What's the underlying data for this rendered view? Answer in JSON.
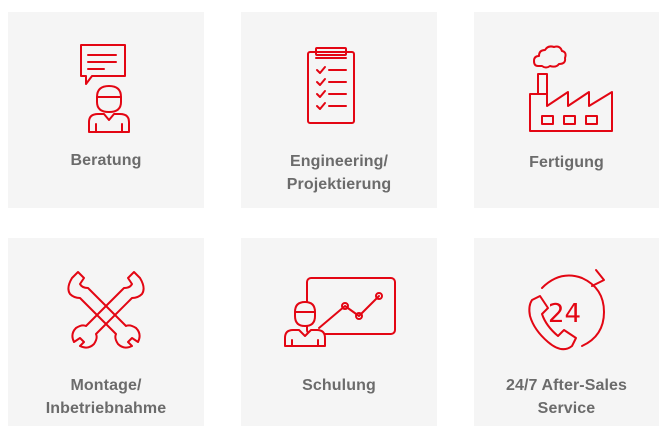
{
  "accent_color": "#e30613",
  "tile_background": "#f5f5f5",
  "label_color": "#6b6b6b",
  "services": [
    {
      "icon": "consultation-icon",
      "label_lines": [
        "Beratung"
      ]
    },
    {
      "icon": "checklist-clipboard-icon",
      "label_lines": [
        "Engineering/",
        "Projektierung"
      ]
    },
    {
      "icon": "factory-icon",
      "label_lines": [
        "Fertigung"
      ]
    },
    {
      "icon": "wrench-tools-icon",
      "label_lines": [
        "Montage/",
        "Inbetriebnahme"
      ]
    },
    {
      "icon": "presentation-training-icon",
      "label_lines": [
        "Schulung"
      ]
    },
    {
      "icon": "24-7-phone-icon",
      "icon_text": "24",
      "label_lines": [
        "24/7 After-Sales",
        "Service"
      ]
    }
  ]
}
